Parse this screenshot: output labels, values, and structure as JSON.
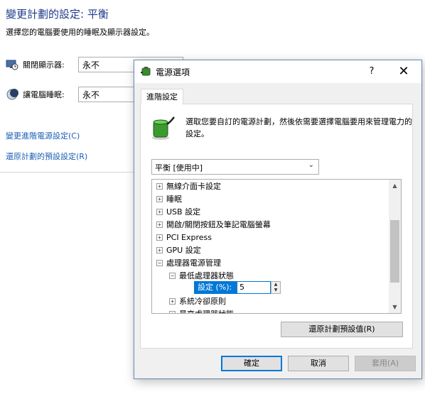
{
  "background": {
    "title": "變更計劃的設定: 平衡",
    "subtitle": "選擇您的電腦要使用的睡眠及顯示器設定。",
    "display_label": "關閉顯示器:",
    "display_value": "永不",
    "sleep_label": "讓電腦睡眠:",
    "sleep_value": "永不",
    "advanced_link": "變更進階電源設定(C)",
    "restore_link": "還原計劃的預設設定(R)"
  },
  "dialog": {
    "title": "電源選項",
    "help": "?",
    "close": "✕",
    "tab": "進階設定",
    "description": "選取您要自訂的電源計劃，然後依需要選擇電腦要用來管理電力的設定。",
    "plan_select": "平衡 [使用中]",
    "tree_items": [
      {
        "expander": "+",
        "label": "無線介面卡設定"
      },
      {
        "expander": "+",
        "label": "睡眠"
      },
      {
        "expander": "+",
        "label": "USB 設定"
      },
      {
        "expander": "+",
        "label": "開啟/關閉按鈕及筆記電腦螢幕"
      },
      {
        "expander": "+",
        "label": "PCI Express"
      },
      {
        "expander": "+",
        "label": "GPU 設定"
      },
      {
        "expander": "−",
        "label": "處理器電源管理"
      },
      {
        "expander": "−",
        "label": "最低處理器狀態"
      },
      {
        "expander": "+",
        "label": "系統冷卻原則"
      },
      {
        "expander": "+",
        "label": "最高處理器狀態"
      }
    ],
    "setting_label": "設定 (%):",
    "setting_value": "5",
    "restore_defaults": "還原計劃預設值(R)",
    "ok": "確定",
    "cancel": "取消",
    "apply": "套用(A)"
  },
  "colors": {
    "accent": "#0078d7",
    "link": "#1a5fb4",
    "title": "#1e3a8a"
  }
}
